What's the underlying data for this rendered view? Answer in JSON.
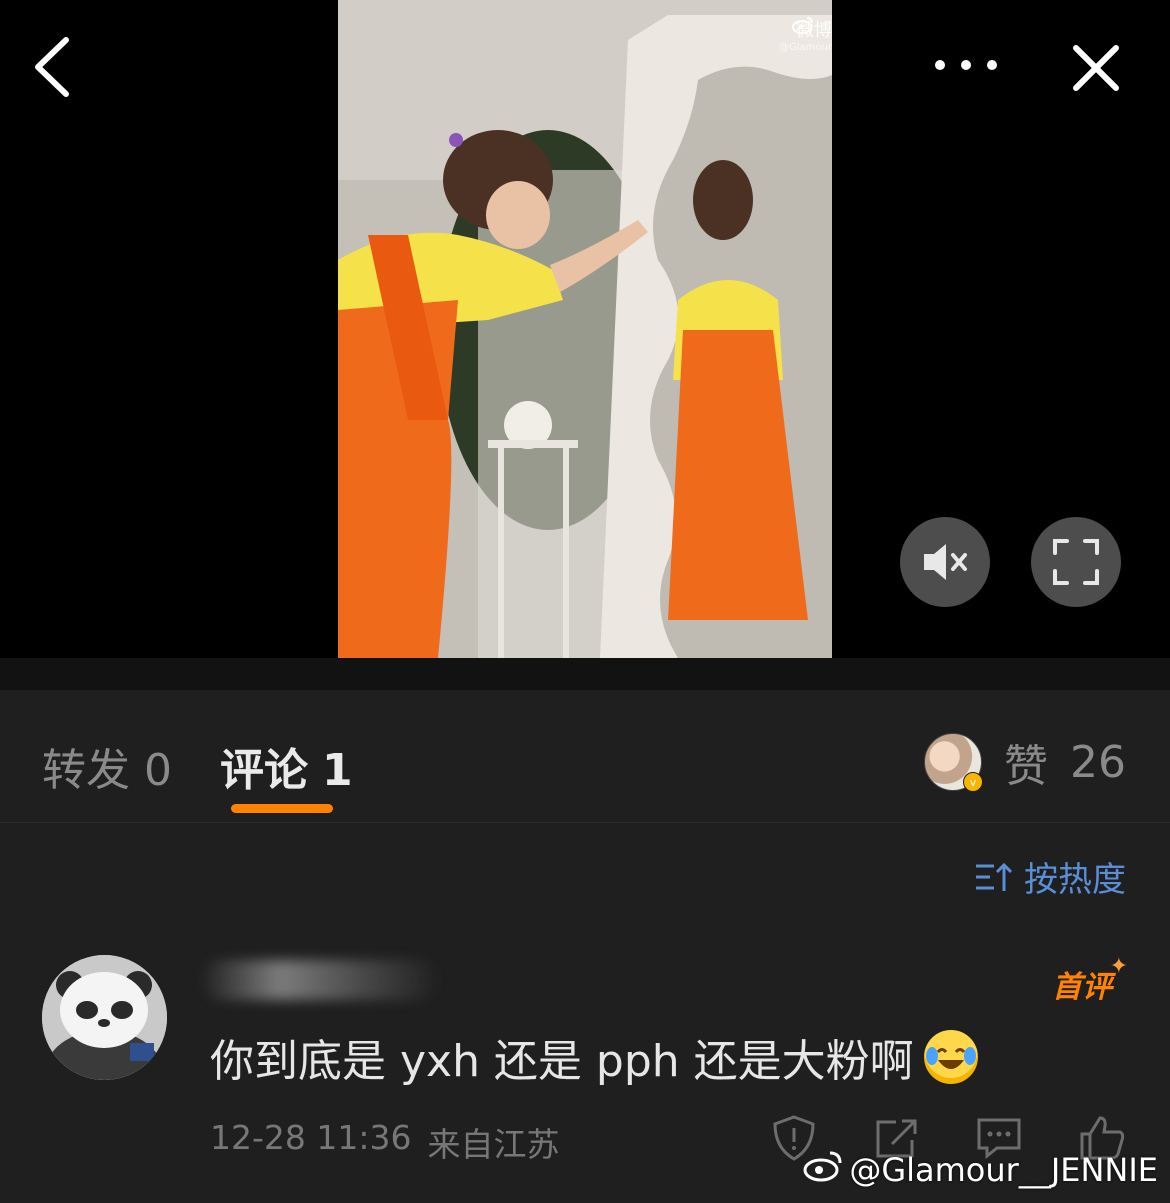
{
  "video": {
    "watermark_cn": "微博",
    "watermark_handle": "@Glamour"
  },
  "tabs": {
    "repost_label": "转发",
    "repost_count": "0",
    "comment_label": "评论",
    "comment_count": "1",
    "like_label": "赞",
    "like_count": "26"
  },
  "sort": {
    "label": "按热度"
  },
  "comment": {
    "badge": "首评",
    "text": "你到底是 yxh 还是 pph 还是大粉啊",
    "time": "12-28 11:36",
    "location": "来自江苏"
  },
  "watermark": {
    "text": "@Glamour__JENNIE"
  },
  "colors": {
    "accent": "#ff8200",
    "link": "#5a8ed6",
    "background": "#1f1f1f"
  }
}
